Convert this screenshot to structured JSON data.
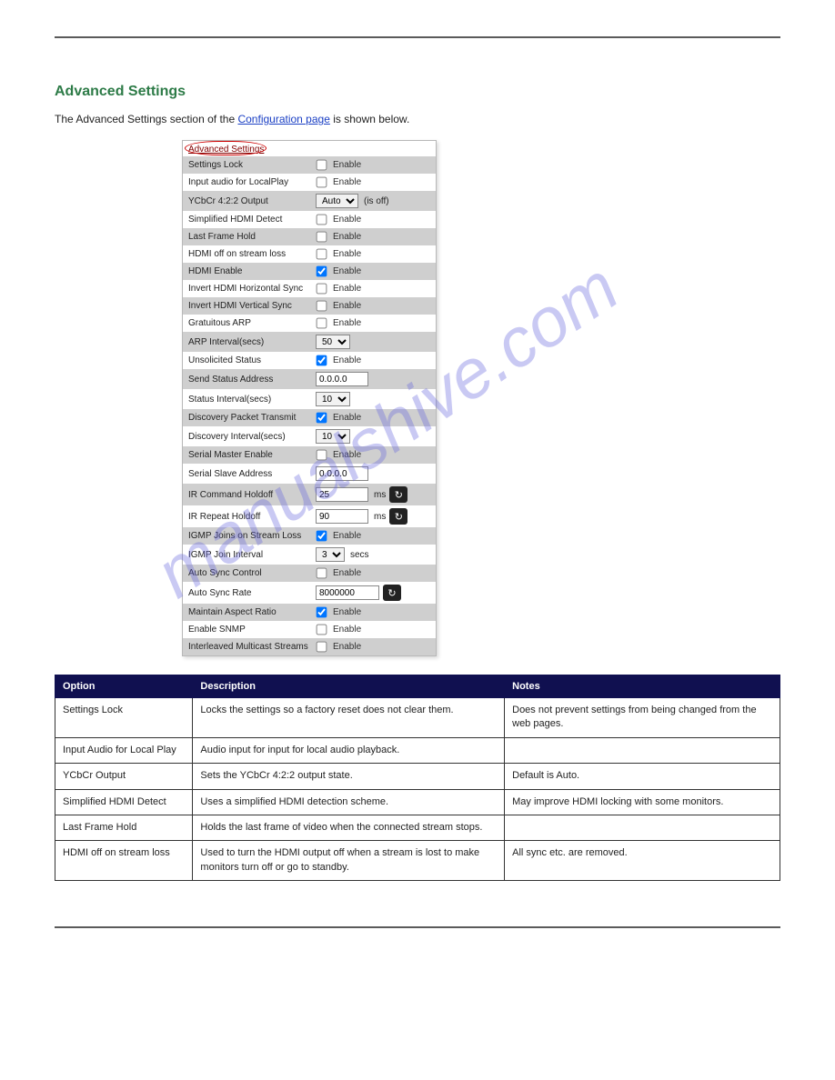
{
  "section": {
    "title": "Advanced Settings",
    "intro_prefix": "The Advanced Settings section of the ",
    "intro_link": "Configuration page",
    "intro_suffix": " is shown below."
  },
  "panel": {
    "header": "Advanced Settings",
    "enable_label": "Enable",
    "ms_label": "ms",
    "secs_label": "secs",
    "isoff_label": "(is off)",
    "rows": [
      {
        "id": "settings-lock",
        "label": "Settings Lock",
        "type": "check",
        "checked": false,
        "alt": true
      },
      {
        "id": "input-audio",
        "label": "Input audio for LocalPlay",
        "type": "check",
        "checked": false,
        "alt": false
      },
      {
        "id": "ycbcr",
        "label": "YCbCr 4:2:2 Output",
        "type": "select_suffix",
        "value": "Auto",
        "suffix": "isoff",
        "alt": true
      },
      {
        "id": "simplified-hdmi",
        "label": "Simplified HDMI Detect",
        "type": "check",
        "checked": false,
        "alt": false
      },
      {
        "id": "last-frame",
        "label": "Last Frame Hold",
        "type": "check",
        "checked": false,
        "alt": true
      },
      {
        "id": "hdmi-off",
        "label": "HDMI off on stream loss",
        "type": "check",
        "checked": false,
        "alt": false
      },
      {
        "id": "hdmi-enable",
        "label": "HDMI Enable",
        "type": "check",
        "checked": true,
        "alt": true
      },
      {
        "id": "inv-hsync",
        "label": "Invert HDMI Horizontal Sync",
        "type": "check",
        "checked": false,
        "alt": false
      },
      {
        "id": "inv-vsync",
        "label": "Invert HDMI Vertical Sync",
        "type": "check",
        "checked": false,
        "alt": true
      },
      {
        "id": "gratuitous-arp",
        "label": "Gratuitous ARP",
        "type": "check",
        "checked": false,
        "alt": false
      },
      {
        "id": "arp-interval",
        "label": "ARP Interval(secs)",
        "type": "select",
        "value": "50",
        "alt": true
      },
      {
        "id": "unsolicited",
        "label": "Unsolicited Status",
        "type": "check",
        "checked": true,
        "alt": false
      },
      {
        "id": "send-status",
        "label": "Send Status Address",
        "type": "text",
        "value": "0.0.0.0",
        "alt": true
      },
      {
        "id": "status-interval",
        "label": "Status Interval(secs)",
        "type": "select",
        "value": "10",
        "alt": false
      },
      {
        "id": "disc-pkt",
        "label": "Discovery Packet Transmit",
        "type": "check",
        "checked": true,
        "alt": true
      },
      {
        "id": "disc-int",
        "label": "Discovery Interval(secs)",
        "type": "select",
        "value": "10",
        "alt": false
      },
      {
        "id": "serial-master",
        "label": "Serial Master Enable",
        "type": "check",
        "checked": false,
        "alt": true
      },
      {
        "id": "serial-slave",
        "label": "Serial Slave Address",
        "type": "text",
        "value": "0.0.0.0",
        "alt": false
      },
      {
        "id": "ir-cmd",
        "label": "IR Command Holdoff",
        "type": "text_ms_reset",
        "value": "25",
        "alt": true
      },
      {
        "id": "ir-rpt",
        "label": "IR Repeat Holdoff",
        "type": "text_ms_reset",
        "value": "90",
        "alt": false
      },
      {
        "id": "igmp-loss",
        "label": "IGMP Joins on Stream Loss",
        "type": "check",
        "checked": true,
        "alt": true
      },
      {
        "id": "igmp-int",
        "label": "IGMP Join Interval",
        "type": "select_secs",
        "value": "3",
        "alt": false
      },
      {
        "id": "auto-sync",
        "label": "Auto Sync Control",
        "type": "check",
        "checked": false,
        "alt": true
      },
      {
        "id": "auto-rate",
        "label": "Auto Sync Rate",
        "type": "text_reset",
        "value": "8000000",
        "alt": false
      },
      {
        "id": "aspect",
        "label": "Maintain Aspect Ratio",
        "type": "check",
        "checked": true,
        "alt": true
      },
      {
        "id": "snmp",
        "label": "Enable SNMP",
        "type": "check",
        "checked": false,
        "alt": false
      },
      {
        "id": "interleaved",
        "label": "Interleaved Multicast Streams",
        "type": "check",
        "checked": false,
        "alt": true
      }
    ]
  },
  "table": {
    "headers": [
      "Option",
      "Description",
      "Notes"
    ],
    "rows": [
      [
        "Settings Lock",
        "Locks the settings so a factory reset does not clear them.",
        "Does not prevent settings from being changed from the web pages."
      ],
      [
        "Input Audio for Local Play",
        "Audio input for input for local audio playback.",
        ""
      ],
      [
        "YCbCr Output",
        "Sets the YCbCr 4:2:2 output state.",
        "Default is Auto."
      ],
      [
        "Simplified HDMI Detect",
        "Uses a simplified HDMI detection scheme.",
        "May improve HDMI locking with some monitors."
      ],
      [
        "Last Frame Hold",
        "Holds the last frame of video when the connected stream stops.",
        ""
      ],
      [
        "HDMI off on stream loss",
        "Used to turn the HDMI output off when a stream is lost to make monitors turn off or go to standby.",
        "All sync etc. are removed."
      ]
    ]
  },
  "watermark": "manualshive.com"
}
